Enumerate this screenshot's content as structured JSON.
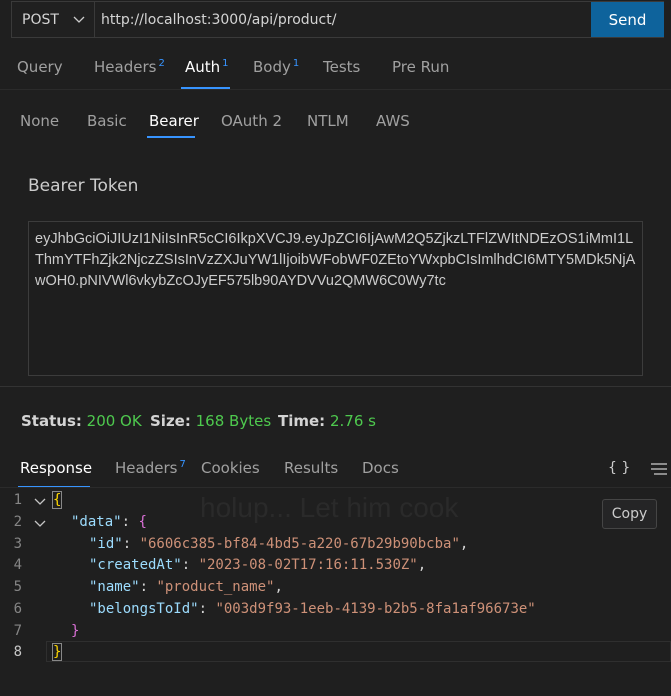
{
  "request": {
    "method": "POST",
    "url": "http://localhost:3000/api/product/",
    "send_label": "Send"
  },
  "request_tabs": [
    {
      "label": "Query"
    },
    {
      "label": "Headers",
      "count": "2"
    },
    {
      "label": "Auth",
      "count": "1",
      "active": true
    },
    {
      "label": "Body",
      "count": "1"
    },
    {
      "label": "Tests"
    },
    {
      "label": "Pre Run"
    }
  ],
  "auth_tabs": [
    "None",
    "Basic",
    "Bearer",
    "OAuth 2",
    "NTLM",
    "AWS"
  ],
  "auth_active": "Bearer",
  "bearer": {
    "label": "Bearer Token",
    "token": "eyJhbGciOiJIUzI1NiIsInR5cCI6IkpXVCJ9.eyJpZCI6IjAwM2Q5ZjkzLTFlZWItNDEzOS1iMmI1LThmYTFhZjk2NjczZSIsInVzZXJuYW1lIjoibWFobWF0ZEtoYWxpbCIsImlhdCI6MTY5MDk5NjAwOH0.pNIVWl6vkybZcOJyEF575lb90AYDVVu2QMW6C0Wy7tc"
  },
  "status": {
    "status_label": "Status:",
    "status_value": "200 OK",
    "size_label": "Size:",
    "size_value": "168 Bytes",
    "time_label": "Time:",
    "time_value": "2.76 s"
  },
  "response_tabs": [
    {
      "label": "Response",
      "active": true
    },
    {
      "label": "Headers",
      "count": "7"
    },
    {
      "label": "Cookies"
    },
    {
      "label": "Results"
    },
    {
      "label": "Docs"
    }
  ],
  "response_tools": {
    "format_label": "{ }",
    "copy_label": "Copy"
  },
  "watermark": "holup... Let him cook",
  "response_body": {
    "line_numbers": [
      "1",
      "2",
      "3",
      "4",
      "5",
      "6",
      "7",
      "8"
    ],
    "open_brace": "{",
    "data_key": "\"data\"",
    "data_open": "{",
    "id_key": "\"id\"",
    "id_value": "\"6606c385-bf84-4bd5-a220-67b29b90bcba\"",
    "created_key": "\"createdAt\"",
    "created_value": "\"2023-08-02T17:16:11.530Z\"",
    "name_key": "\"name\"",
    "name_value": "\"product_name\"",
    "belongs_key": "\"belongsToId\"",
    "belongs_value": "\"003d9f93-1eeb-4139-b2b5-8fa1af96673e\"",
    "data_close": "}",
    "close_brace": "}",
    "colon": ": ",
    "comma": ","
  },
  "colors": {
    "accent": "#3794ff",
    "send_button": "#0e639c",
    "status_ok": "#4ec94e",
    "json_key": "#9cdcfe",
    "json_string": "#ce9178"
  },
  "icons": [
    "chevron-down-icon",
    "fold-chevron-icon",
    "menu-icon"
  ]
}
